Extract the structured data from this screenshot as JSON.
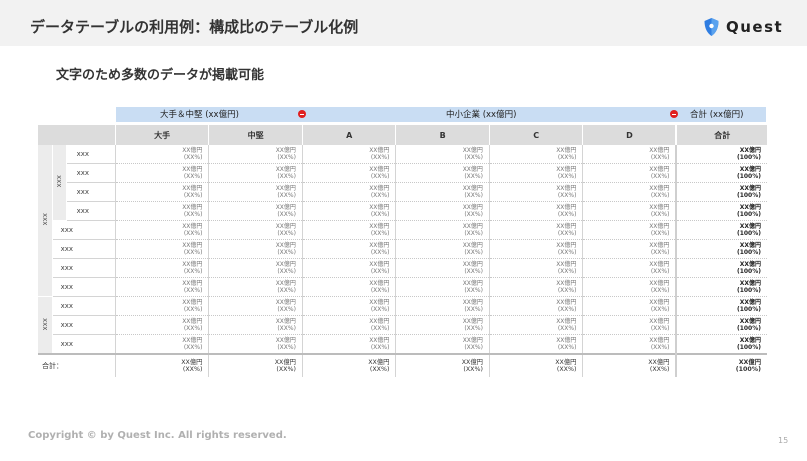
{
  "header": {
    "title": "データテーブルの利用例：構成比のテーブル化例",
    "logo_text": "Quest",
    "logo_icon": "quest-shield-logo",
    "brand_color": "#2f7de1"
  },
  "subtitle": "文字のため多数のデータが掲載可能",
  "group_headers": {
    "large_mid": "大手＆中堅 (xx億円)",
    "sme": "中小企業 (xx億円)",
    "total": "合計 (xx億円)"
  },
  "columns": [
    "大手",
    "中堅",
    "A",
    "B",
    "C",
    "D",
    "合計"
  ],
  "outer_groups": [
    "xxx",
    "xxx"
  ],
  "inner_group": "xxx",
  "rows": [
    {
      "label": "xxx",
      "cells": [
        [
          "XX億円",
          "(XX%)"
        ],
        [
          "XX億円",
          "(XX%)"
        ],
        [
          "XX億円",
          "(XX%)"
        ],
        [
          "XX億円",
          "(XX%)"
        ],
        [
          "XX億円",
          "(XX%)"
        ],
        [
          "XX億円",
          "(XX%)"
        ],
        [
          "XX億円",
          "(100%)"
        ]
      ]
    },
    {
      "label": "xxx",
      "cells": [
        [
          "XX億円",
          "(XX%)"
        ],
        [
          "XX億円",
          "(XX%)"
        ],
        [
          "XX億円",
          "(XX%)"
        ],
        [
          "XX億円",
          "(XX%)"
        ],
        [
          "XX億円",
          "(XX%)"
        ],
        [
          "XX億円",
          "(XX%)"
        ],
        [
          "XX億円",
          "(100%)"
        ]
      ]
    },
    {
      "label": "xxx",
      "cells": [
        [
          "XX億円",
          "(XX%)"
        ],
        [
          "XX億円",
          "(XX%)"
        ],
        [
          "XX億円",
          "(XX%)"
        ],
        [
          "XX億円",
          "(XX%)"
        ],
        [
          "XX億円",
          "(XX%)"
        ],
        [
          "XX億円",
          "(XX%)"
        ],
        [
          "XX億円",
          "(100%)"
        ]
      ]
    },
    {
      "label": "xxx",
      "cells": [
        [
          "XX億円",
          "(XX%)"
        ],
        [
          "XX億円",
          "(XX%)"
        ],
        [
          "XX億円",
          "(XX%)"
        ],
        [
          "XX億円",
          "(XX%)"
        ],
        [
          "XX億円",
          "(XX%)"
        ],
        [
          "XX億円",
          "(XX%)"
        ],
        [
          "XX億円",
          "(100%)"
        ]
      ]
    },
    {
      "label": "xxx",
      "cells": [
        [
          "XX億円",
          "(XX%)"
        ],
        [
          "XX億円",
          "(XX%)"
        ],
        [
          "XX億円",
          "(XX%)"
        ],
        [
          "XX億円",
          "(XX%)"
        ],
        [
          "XX億円",
          "(XX%)"
        ],
        [
          "XX億円",
          "(XX%)"
        ],
        [
          "XX億円",
          "(100%)"
        ]
      ]
    },
    {
      "label": "xxx",
      "cells": [
        [
          "XX億円",
          "(XX%)"
        ],
        [
          "XX億円",
          "(XX%)"
        ],
        [
          "XX億円",
          "(XX%)"
        ],
        [
          "XX億円",
          "(XX%)"
        ],
        [
          "XX億円",
          "(XX%)"
        ],
        [
          "XX億円",
          "(XX%)"
        ],
        [
          "XX億円",
          "(100%)"
        ]
      ]
    },
    {
      "label": "xxx",
      "cells": [
        [
          "XX億円",
          "(XX%)"
        ],
        [
          "XX億円",
          "(XX%)"
        ],
        [
          "XX億円",
          "(XX%)"
        ],
        [
          "XX億円",
          "(XX%)"
        ],
        [
          "XX億円",
          "(XX%)"
        ],
        [
          "XX億円",
          "(XX%)"
        ],
        [
          "XX億円",
          "(100%)"
        ]
      ]
    },
    {
      "label": "xxx",
      "cells": [
        [
          "XX億円",
          "(XX%)"
        ],
        [
          "XX億円",
          "(XX%)"
        ],
        [
          "XX億円",
          "(XX%)"
        ],
        [
          "XX億円",
          "(XX%)"
        ],
        [
          "XX億円",
          "(XX%)"
        ],
        [
          "XX億円",
          "(XX%)"
        ],
        [
          "XX億円",
          "(100%)"
        ]
      ]
    },
    {
      "label": "xxx",
      "cells": [
        [
          "XX億円",
          "(XX%)"
        ],
        [
          "XX億円",
          "(XX%)"
        ],
        [
          "XX億円",
          "(XX%)"
        ],
        [
          "XX億円",
          "(XX%)"
        ],
        [
          "XX億円",
          "(XX%)"
        ],
        [
          "XX億円",
          "(XX%)"
        ],
        [
          "XX億円",
          "(100%)"
        ]
      ]
    },
    {
      "label": "xxx",
      "cells": [
        [
          "XX億円",
          "(XX%)"
        ],
        [
          "XX億円",
          "(XX%)"
        ],
        [
          "XX億円",
          "(XX%)"
        ],
        [
          "XX億円",
          "(XX%)"
        ],
        [
          "XX億円",
          "(XX%)"
        ],
        [
          "XX億円",
          "(XX%)"
        ],
        [
          "XX億円",
          "(100%)"
        ]
      ]
    },
    {
      "label": "xxx",
      "cells": [
        [
          "XX億円",
          "(XX%)"
        ],
        [
          "XX億円",
          "(XX%)"
        ],
        [
          "XX億円",
          "(XX%)"
        ],
        [
          "XX億円",
          "(XX%)"
        ],
        [
          "XX億円",
          "(XX%)"
        ],
        [
          "XX億円",
          "(XX%)"
        ],
        [
          "XX億円",
          "(100%)"
        ]
      ]
    }
  ],
  "summary": {
    "label": "合計：",
    "cells": [
      [
        "XX億円",
        "(XX%)"
      ],
      [
        "XX億円",
        "(XX%)"
      ],
      [
        "XX億円",
        "(XX%)"
      ],
      [
        "XX億円",
        "(XX%)"
      ],
      [
        "XX億円",
        "(XX%)"
      ],
      [
        "XX億円",
        "(XX%)"
      ],
      [
        "XX億円",
        "(100%)"
      ]
    ]
  },
  "footer": {
    "copyright": "Copyright © by Quest Inc. All rights reserved.",
    "page_number": "15"
  }
}
